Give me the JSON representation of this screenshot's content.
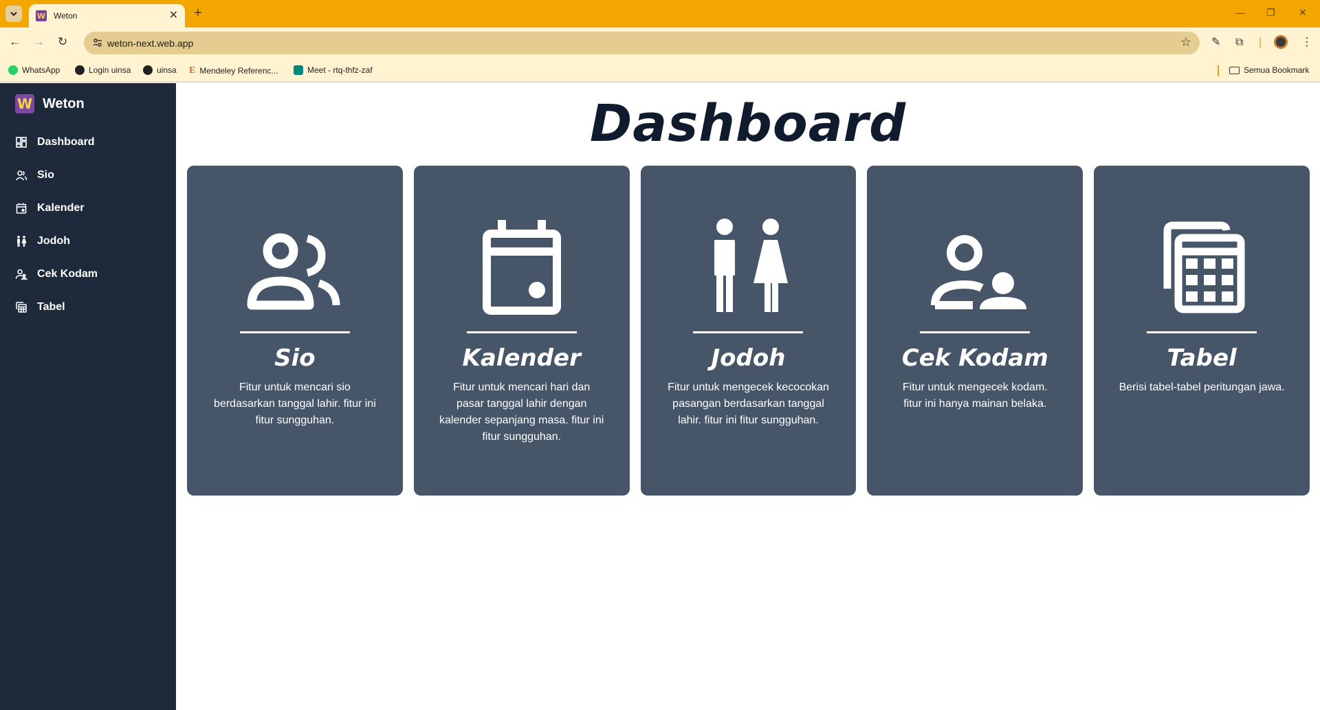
{
  "browser": {
    "tab_title": "Weton",
    "tab_favicon_letter": "W",
    "new_tab": "+",
    "url": "weton-next.web.app",
    "bookmarks": [
      {
        "label": "WhatsApp",
        "icon": "whatsapp-icon",
        "color": "#25d366"
      },
      {
        "label": "Login uinsa",
        "icon": "globe-icon",
        "color": "#222222"
      },
      {
        "label": "uinsa",
        "icon": "globe-icon",
        "color": "#222222"
      },
      {
        "label": "Mendeley Referenc...",
        "icon": "mendeley-icon",
        "color": "#e0642b"
      },
      {
        "label": "Meet - rtq-thfz-zaf",
        "icon": "meet-icon",
        "color": "#00897b"
      }
    ],
    "all_bookmarks": "Semua Bookmark",
    "colors": {
      "tabbar": "#f4a600",
      "toolbar": "#fff3d1",
      "omnibox": "#e5cc90"
    }
  },
  "app": {
    "logo_letter": "W",
    "name": "Weton",
    "nav": [
      {
        "label": "Dashboard",
        "icon": "dashboard-grid-icon"
      },
      {
        "label": "Sio",
        "icon": "users-icon"
      },
      {
        "label": "Kalender",
        "icon": "calendar-icon"
      },
      {
        "label": "Jodoh",
        "icon": "man-woman-icon"
      },
      {
        "label": "Cek Kodam",
        "icon": "user-check-icon"
      },
      {
        "label": "Tabel",
        "icon": "table-icon"
      }
    ],
    "colors": {
      "sidebar": "#1e293b",
      "card": "#475569",
      "title": "#111b2e",
      "logo": "#7b4a9e"
    }
  },
  "dashboard": {
    "title": "Dashboard",
    "cards": [
      {
        "title": "Sio",
        "description": "Fitur untuk mencari sio berdasarkan tanggal lahir. fitur ini fitur sungguhan.",
        "icon": "users-icon"
      },
      {
        "title": "Kalender",
        "description": "Fitur untuk mencari hari dan pasar tanggal lahir dengan kalender sepanjang masa. fitur ini fitur sungguhan.",
        "icon": "calendar-icon"
      },
      {
        "title": "Jodoh",
        "description": "Fitur untuk mengecek kecocokan pasangan berdasarkan tanggal lahir. fitur ini fitur sungguhan.",
        "icon": "man-woman-icon"
      },
      {
        "title": "Cek Kodam",
        "description": "Fitur untuk mengecek kodam. fitur ini hanya mainan belaka.",
        "icon": "user-check-icon"
      },
      {
        "title": "Tabel",
        "description": "Berisi tabel-tabel peritungan jawa.",
        "icon": "table-icon"
      }
    ]
  }
}
